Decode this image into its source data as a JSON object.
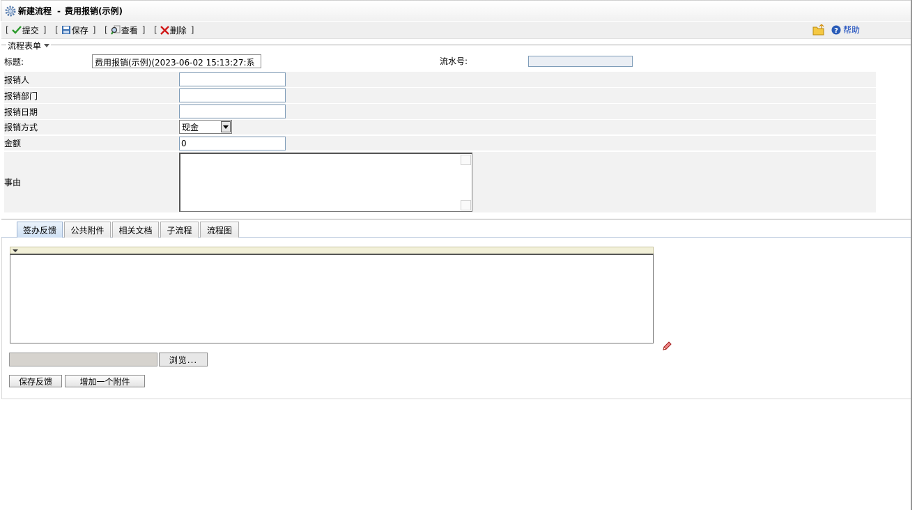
{
  "window": {
    "title": "新建流程",
    "separator": "-",
    "subtitle": "费用报销(示例)"
  },
  "toolbar": {
    "submit_label": "提交",
    "save_label": "保存",
    "view_label": "查看",
    "delete_label": "删除",
    "help_label": "帮助",
    "bracket_open": "[",
    "bracket_close": "]"
  },
  "form": {
    "legend": "流程表单",
    "title_label": "标题:",
    "title_value": "费用报销(示例)(2023-06-02 15:13:27:系",
    "serial_label": "流水号:",
    "serial_value": "",
    "rows": [
      {
        "label": "报销人",
        "value": ""
      },
      {
        "label": "报销部门",
        "value": ""
      },
      {
        "label": "报销日期",
        "value": ""
      },
      {
        "label": "报销方式",
        "value": "现金"
      },
      {
        "label": "金额",
        "value": "0"
      },
      {
        "label": "事由",
        "value": ""
      }
    ]
  },
  "tabs": [
    {
      "label": "签办反馈",
      "active": true
    },
    {
      "label": "公共附件",
      "active": false
    },
    {
      "label": "相关文档",
      "active": false
    },
    {
      "label": "子流程",
      "active": false
    },
    {
      "label": "流程图",
      "active": false
    }
  ],
  "feedback": {
    "content": "",
    "browse_label": "浏览...",
    "save_feedback_label": "保存反馈",
    "add_attachment_label": "增加一个附件"
  },
  "icons": {
    "title": "gear-icon",
    "submit": "check-icon",
    "save": "disk-icon",
    "view": "magnifier-icon",
    "delete": "red-x-icon",
    "folder": "folder-icon",
    "help": "help-icon",
    "edit": "pencil-icon"
  }
}
